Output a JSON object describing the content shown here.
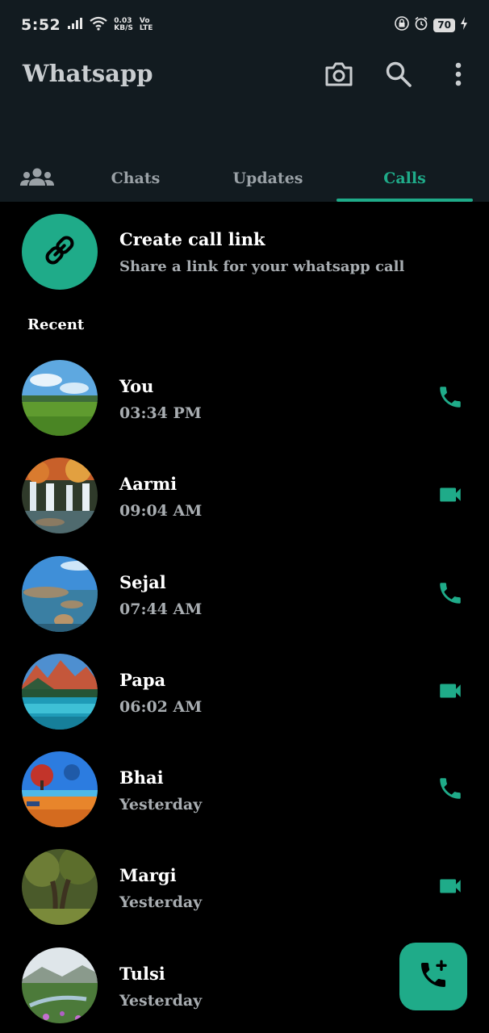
{
  "status_bar": {
    "time": "5:52",
    "net_speed_value": "0.03",
    "net_speed_unit": "KB/S",
    "volte_top": "Vo",
    "volte_bottom": "LTE",
    "battery": "70",
    "icons": [
      "signal-icon",
      "wifi-icon",
      "lock-icon",
      "alarm-icon",
      "charging-icon"
    ]
  },
  "header": {
    "title": "Whatsapp",
    "icons": [
      "camera-icon",
      "search-icon",
      "more-vert-icon"
    ]
  },
  "tabs": [
    {
      "label": "Chats",
      "active": false
    },
    {
      "label": "Updates",
      "active": false
    },
    {
      "label": "Calls",
      "active": true
    }
  ],
  "create_link": {
    "title": "Create call link",
    "subtitle": "Share a link for your whatsapp call"
  },
  "recent_label": "Recent",
  "calls": [
    {
      "name": "You",
      "time": "03:34 PM",
      "type": "voice"
    },
    {
      "name": "Aarmi",
      "time": "09:04 AM",
      "type": "video"
    },
    {
      "name": "Sejal",
      "time": "07:44 AM",
      "type": "voice"
    },
    {
      "name": "Papa",
      "time": "06:02 AM",
      "type": "video"
    },
    {
      "name": "Bhai",
      "time": "Yesterday",
      "type": "voice"
    },
    {
      "name": "Margi",
      "time": "Yesterday",
      "type": "video"
    },
    {
      "name": "Tulsi",
      "time": "Yesterday",
      "type": "voice"
    }
  ],
  "colors": {
    "accent": "#1fab89",
    "header_bg": "#121b20",
    "background": "#000000",
    "secondary_text": "#a8adb1"
  }
}
